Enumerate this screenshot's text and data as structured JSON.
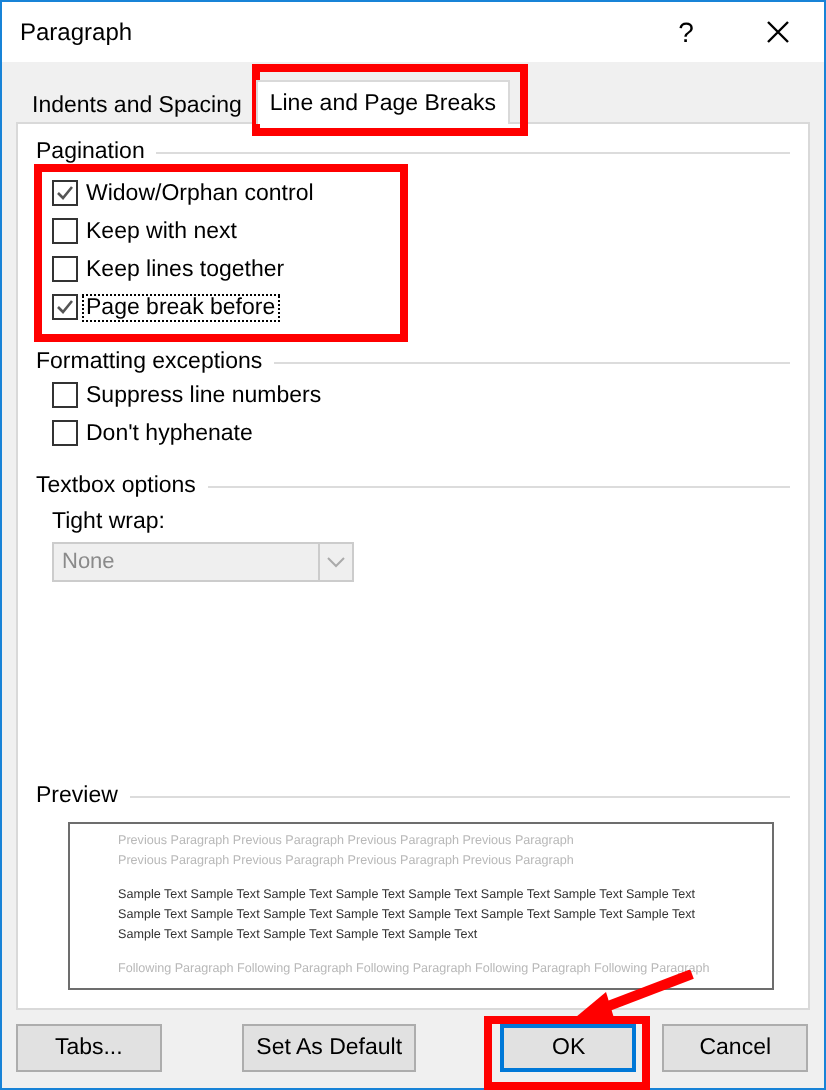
{
  "window": {
    "title": "Paragraph",
    "help": "?"
  },
  "tabs": [
    {
      "label": "Indents and Spacing",
      "selected": false
    },
    {
      "label": "Line and Page Breaks",
      "selected": true
    }
  ],
  "sections": [
    {
      "title": "Pagination",
      "checkboxes": [
        {
          "label": "Widow/Orphan control",
          "checked": true,
          "focused": false
        },
        {
          "label": "Keep with next",
          "checked": false,
          "focused": false
        },
        {
          "label": "Keep lines together",
          "checked": false,
          "focused": false
        },
        {
          "label": "Page break before",
          "checked": true,
          "focused": true
        }
      ]
    },
    {
      "title": "Formatting exceptions",
      "checkboxes": [
        {
          "label": "Suppress line numbers",
          "checked": false,
          "focused": false
        },
        {
          "label": "Don't hyphenate",
          "checked": false,
          "focused": false
        }
      ]
    }
  ],
  "textbox_options": {
    "title": "Textbox options",
    "label": "Tight wrap:",
    "value": "None",
    "disabled": true
  },
  "preview": {
    "title": "Preview",
    "lines": [
      {
        "kind": "faded",
        "text": "Previous Paragraph Previous Paragraph Previous Paragraph Previous Paragraph"
      },
      {
        "kind": "faded",
        "text": "Previous Paragraph Previous Paragraph Previous Paragraph Previous Paragraph"
      },
      {
        "kind": "gap"
      },
      {
        "kind": "sample",
        "text": "Sample Text Sample Text Sample Text Sample Text Sample Text Sample Text Sample Text Sample Text"
      },
      {
        "kind": "sample",
        "text": "Sample Text Sample Text Sample Text Sample Text Sample Text Sample Text Sample Text Sample Text"
      },
      {
        "kind": "sample",
        "text": "Sample Text Sample Text Sample Text Sample Text Sample Text"
      },
      {
        "kind": "gap"
      },
      {
        "kind": "faded",
        "text": "Following Paragraph Following Paragraph Following Paragraph Following Paragraph Following Paragraph"
      }
    ]
  },
  "buttons": [
    {
      "label": "Tabs...",
      "default": false
    },
    {
      "label": "Set As Default",
      "default": false
    },
    {
      "label": "OK",
      "default": true
    },
    {
      "label": "Cancel",
      "default": false
    }
  ]
}
